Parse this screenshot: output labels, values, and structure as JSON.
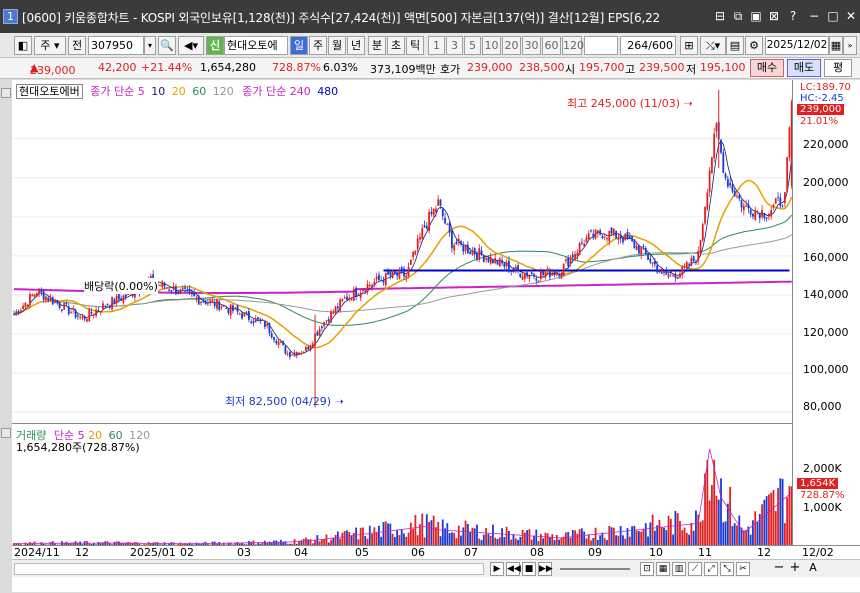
{
  "window": {
    "number": "1",
    "title": "[0600] 키움종합차트 - KOSPI 외국인보유[1,128(천)] 주식수[27,424(천)] 액면[500] 자본금[137(억)] 결산[12월] EPS[6,22"
  },
  "toolbar": {
    "type_label": "주",
    "all_label": "전",
    "code": "307950",
    "badge": "신",
    "stock_name": "현대오토에",
    "period_tabs": [
      "일",
      "주",
      "월",
      "년",
      "분",
      "초",
      "틱"
    ],
    "active_period": "일",
    "intervals": [
      "1",
      "3",
      "5",
      "10",
      "20",
      "30",
      "60",
      "120"
    ],
    "count": "264",
    "count_total": "/600",
    "date": "2025/12/02"
  },
  "quote": {
    "price": "239,000",
    "change": "42,200",
    "change_rate": "+21.44%",
    "volume": "1,654,280",
    "volume_rate": "728.87%",
    "turnover": "6.03%",
    "amount": "373,109백만",
    "bid_label": "호가",
    "bid1": "239,000",
    "bid2": "238,500",
    "open_label": "시",
    "open": "195,700",
    "high_label": "고",
    "high": "239,500",
    "low_label": "저",
    "low": "195,100",
    "buy_label": "매수",
    "sell_label": "매도",
    "eval_label": "평"
  },
  "colors": {
    "up": "#e02020",
    "down": "#1a3ad0",
    "ma5": "#1a1a6e",
    "ma10": "#1a1a6e",
    "ma20": "#e8a000",
    "ma60": "#2e8b57",
    "ma120": "#999999",
    "ma240": "#cc22cc",
    "ma480": "#0000cc"
  },
  "main_legend": {
    "name": "현대오토에버",
    "ma_label": "종가 단순",
    "periods": [
      "5",
      "10",
      "20",
      "60",
      "120"
    ],
    "ma2_label": "종가 단순 240",
    "ma2_period": "480"
  },
  "annotations": {
    "high": "최고 245,000 (11/03)",
    "low": "최저 82,500 (04/29)",
    "dividend": "배당락(0.00%)"
  },
  "right_tags": {
    "lc": "LC:189.70",
    "hc": "HC:-2.45",
    "price": "239,000",
    "pct": "21.01%",
    "vol": "1,654K",
    "vol_pct": "728.87%"
  },
  "vol_legend": {
    "name": "거래량",
    "ma_label": "단순",
    "periods": [
      "5",
      "20",
      "60",
      "120"
    ],
    "value": "1,654,280주(728.87%)"
  },
  "chart_data": {
    "type": "candlestick",
    "price_ticks": [
      "220,000",
      "200,000",
      "180,000",
      "160,000",
      "140,000",
      "120,000",
      "100,000",
      "80,000"
    ],
    "volume_ticks": [
      "2,000K",
      "1,000K"
    ],
    "x_ticks": [
      "2024/11",
      "12",
      "2025/01",
      "02",
      "03",
      "04",
      "05",
      "06",
      "07",
      "08",
      "09",
      "10",
      "11",
      "12",
      "12/02"
    ],
    "ylim": [
      75000,
      250000
    ],
    "volume_ylim": [
      0,
      3000
    ],
    "close_series_approx": [
      [
        0,
        130000
      ],
      [
        10,
        142000
      ],
      [
        20,
        135000
      ],
      [
        30,
        128000
      ],
      [
        40,
        135000
      ],
      [
        50,
        140000
      ],
      [
        60,
        147000
      ],
      [
        70,
        143000
      ],
      [
        80,
        138000
      ],
      [
        90,
        135000
      ],
      [
        100,
        130000
      ],
      [
        110,
        125000
      ],
      [
        120,
        110000
      ],
      [
        128,
        112000
      ],
      [
        135,
        125000
      ],
      [
        145,
        138000
      ],
      [
        155,
        145000
      ],
      [
        165,
        150000
      ],
      [
        172,
        150000
      ],
      [
        180,
        175000
      ],
      [
        186,
        187000
      ],
      [
        192,
        167000
      ],
      [
        200,
        163000
      ],
      [
        210,
        158000
      ],
      [
        220,
        152000
      ],
      [
        230,
        150000
      ],
      [
        240,
        153000
      ],
      [
        250,
        168000
      ],
      [
        258,
        172000
      ],
      [
        266,
        170000
      ],
      [
        275,
        163000
      ],
      [
        285,
        150000
      ],
      [
        293,
        152000
      ],
      [
        300,
        160000
      ],
      [
        305,
        205000
      ],
      [
        308,
        225000
      ],
      [
        312,
        200000
      ],
      [
        320,
        185000
      ],
      [
        330,
        182000
      ],
      [
        338,
        190000
      ],
      [
        341,
        239000
      ]
    ],
    "volume_series_approx": [
      [
        0,
        80
      ],
      [
        40,
        90
      ],
      [
        80,
        70
      ],
      [
        120,
        120
      ],
      [
        135,
        200
      ],
      [
        180,
        600
      ],
      [
        186,
        500
      ],
      [
        240,
        250
      ],
      [
        300,
        700
      ],
      [
        305,
        3000
      ],
      [
        310,
        1500
      ],
      [
        320,
        400
      ],
      [
        341,
        1654
      ]
    ]
  }
}
